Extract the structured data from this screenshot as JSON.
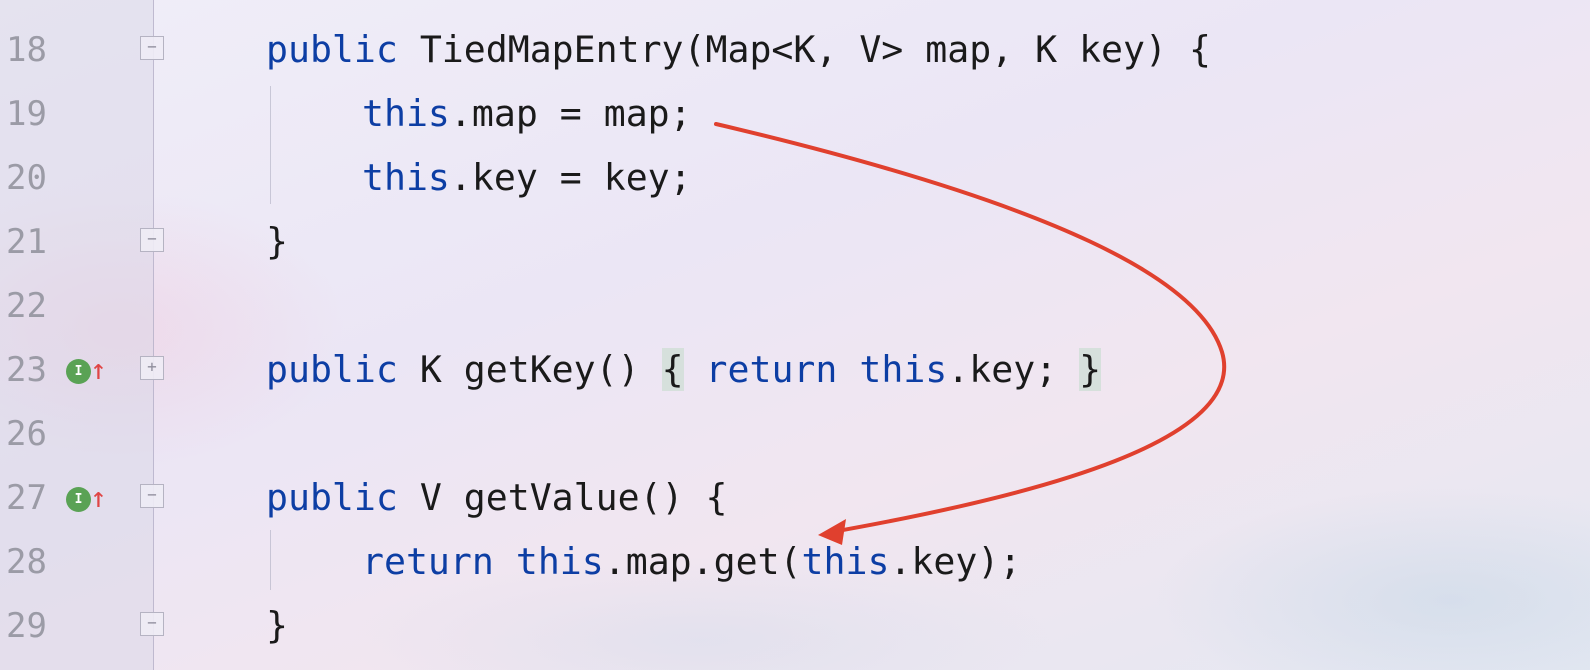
{
  "editor": {
    "accent_colors": {
      "keyword": "#0d3ea4",
      "text": "#1a1a1a",
      "line_number": "#9b9ba6",
      "annotation_arrow": "#e0402e",
      "implements_badge": "#5aa255"
    },
    "lines": [
      {
        "number": "18",
        "tokens": [
          [
            "kw",
            "public"
          ],
          [
            "t",
            " TiedMapEntry(Map<K, V> map, K key) {"
          ]
        ],
        "indent": 0,
        "fold": "open",
        "badge": false
      },
      {
        "number": "19",
        "tokens": [
          [
            "kw",
            "this"
          ],
          [
            "t",
            ".map = map;"
          ]
        ],
        "indent": 1,
        "fold": "",
        "badge": false
      },
      {
        "number": "20",
        "tokens": [
          [
            "kw",
            "this"
          ],
          [
            "t",
            ".key = key;"
          ]
        ],
        "indent": 1,
        "fold": "",
        "badge": false
      },
      {
        "number": "21",
        "tokens": [
          [
            "t",
            "}"
          ]
        ],
        "indent": 0,
        "fold": "close",
        "badge": false
      },
      {
        "number": "22",
        "tokens": [],
        "indent": 0,
        "fold": "",
        "badge": false
      },
      {
        "number": "23",
        "tokens": [
          [
            "kw",
            "public"
          ],
          [
            "t",
            " K getKey() "
          ],
          [
            "hl",
            "{"
          ],
          [
            "t",
            " "
          ],
          [
            "kw",
            "return"
          ],
          [
            "t",
            " "
          ],
          [
            "kw",
            "this"
          ],
          [
            "t",
            ".key; "
          ],
          [
            "hl",
            "}"
          ]
        ],
        "indent": 0,
        "fold": "collapsed",
        "badge": true
      },
      {
        "number": "26",
        "tokens": [],
        "indent": 0,
        "fold": "",
        "badge": false
      },
      {
        "number": "27",
        "tokens": [
          [
            "kw",
            "public"
          ],
          [
            "t",
            " V getValue() {"
          ]
        ],
        "indent": 0,
        "fold": "open",
        "badge": true
      },
      {
        "number": "28",
        "tokens": [
          [
            "kw",
            "return"
          ],
          [
            "t",
            " "
          ],
          [
            "kw",
            "this"
          ],
          [
            "t",
            ".map.get("
          ],
          [
            "kw",
            "this"
          ],
          [
            "t",
            ".key);"
          ]
        ],
        "indent": 1,
        "fold": "",
        "badge": false
      },
      {
        "number": "29",
        "tokens": [
          [
            "t",
            "}"
          ]
        ],
        "indent": 0,
        "fold": "close",
        "badge": false
      }
    ],
    "badge_label": "I",
    "fold_open_symbol": "−",
    "fold_collapsed_symbol": "+",
    "up_arrow_symbol": "↑"
  }
}
